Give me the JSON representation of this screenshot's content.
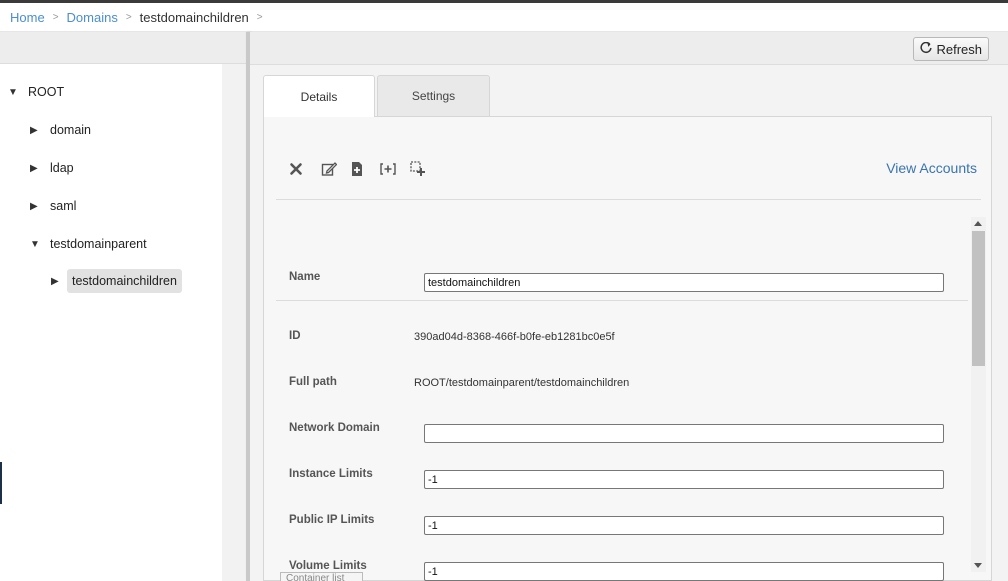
{
  "breadcrumb": {
    "home": "Home",
    "domains": "Domains",
    "current": "testdomainchildren",
    "separator": ">"
  },
  "tree": {
    "root": "ROOT",
    "items": [
      {
        "label": "domain"
      },
      {
        "label": "ldap"
      },
      {
        "label": "saml"
      },
      {
        "label": "testdomainparent"
      },
      {
        "label": "testdomainchildren"
      }
    ]
  },
  "header": {
    "refresh_label": "Refresh"
  },
  "tabs": [
    {
      "label": "Details"
    },
    {
      "label": "Settings"
    }
  ],
  "toolbar": {
    "icons": [
      "delete-icon",
      "edit-icon",
      "add-domain-icon",
      "link-ldap-icon",
      "import-ldap-icon"
    ],
    "view_accounts": "View Accounts"
  },
  "form": {
    "name_label": "Name",
    "name_value": "testdomainchildren",
    "id_label": "ID",
    "id_value": "390ad04d-8368-466f-b0fe-eb1281bc0e5f",
    "fullpath_label": "Full path",
    "fullpath_value": "ROOT/testdomainparent/testdomainchildren",
    "network_domain_label": "Network Domain",
    "network_domain_value": "",
    "instance_limits_label": "Instance Limits",
    "instance_limits_value": "-1",
    "public_ip_limits_label": "Public IP Limits",
    "public_ip_limits_value": "-1",
    "volume_limits_label": "Volume Limits",
    "volume_limits_value": "-1"
  },
  "footer": {
    "container_list": "Container list"
  },
  "colors": {
    "link": "#4a8fd0",
    "accent": "#3a74b0"
  }
}
